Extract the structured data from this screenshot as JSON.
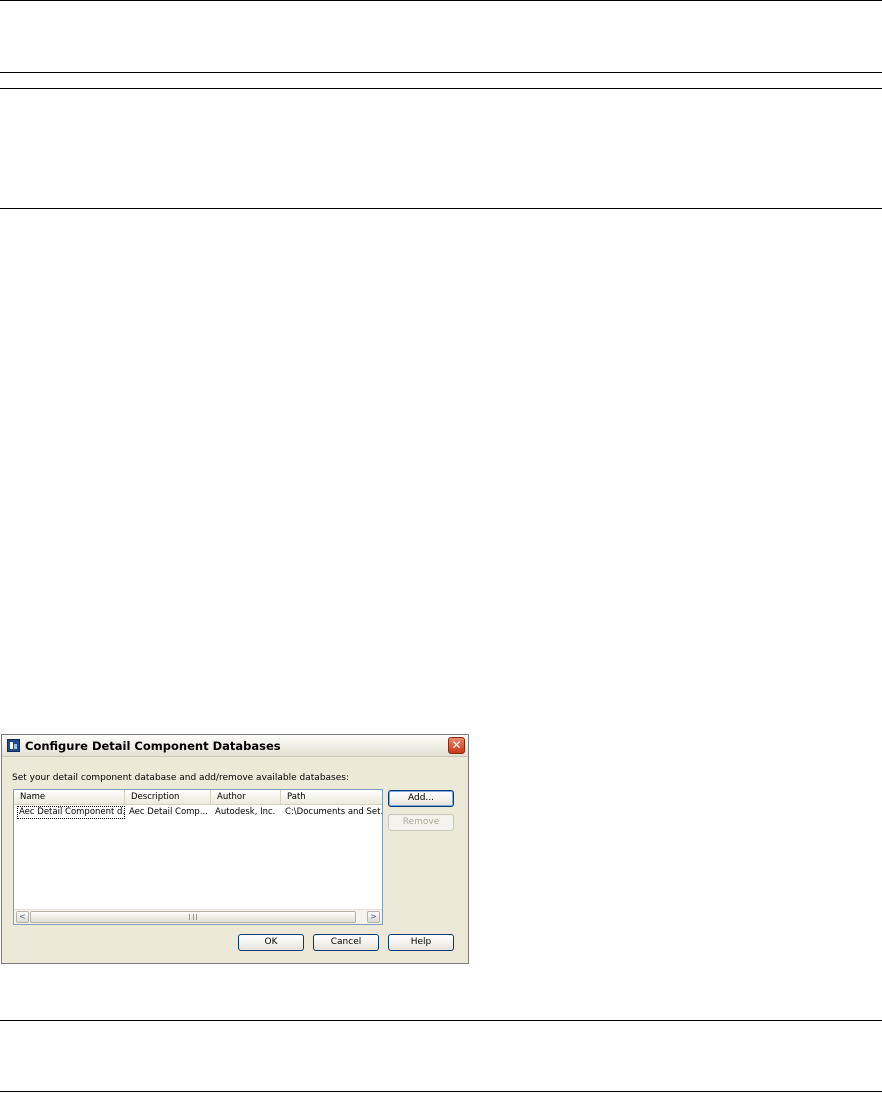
{
  "dialog": {
    "title": "Configure Detail Component Databases",
    "instruction": "Set your detail component database and add/remove available databases:",
    "columns": [
      "Name",
      "Description",
      "Author",
      "Path"
    ],
    "rows": [
      [
        "Aec Detail Component d...",
        "Aec Detail Comp...",
        "Autodesk, Inc.",
        "C:\\Documents and Set..."
      ]
    ],
    "buttons": {
      "add": "Add...",
      "remove": "Remove",
      "ok": "OK",
      "cancel": "Cancel",
      "help": "Help"
    },
    "scroll": {
      "left_arrow": "<",
      "right_arrow": ">"
    },
    "close_glyph": "✕"
  },
  "colors": {
    "dialog_bg": "#ece9d8",
    "close_red": "#c8381a",
    "list_border": "#7f9db9",
    "button_border": "#003c74"
  }
}
